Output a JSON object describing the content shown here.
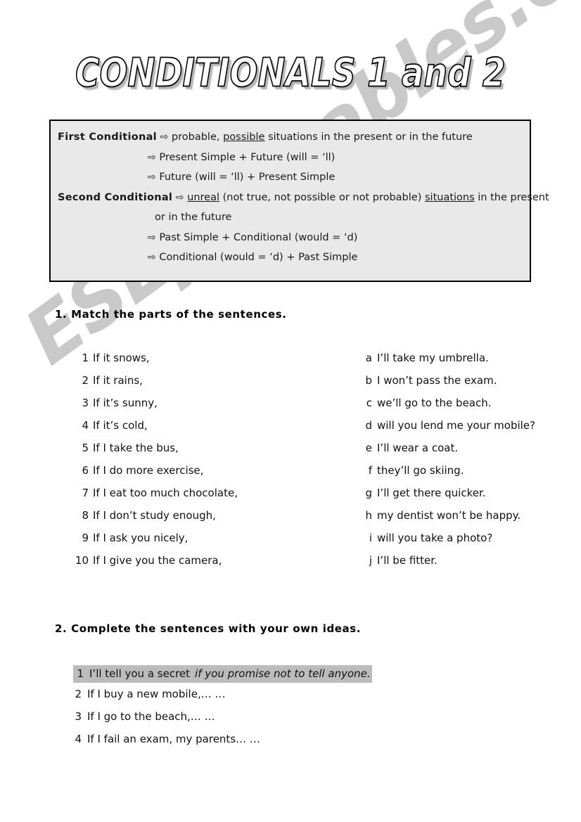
{
  "watermark": {
    "text": "ESLprintables.com"
  },
  "title": {
    "text": "CONDITIONALS 1 and 2"
  },
  "grammar_box": {
    "arrow_icon": "⇨",
    "lines": [
      {
        "label": "First Conditional",
        "indent": "head",
        "arrow": true,
        "parts": [
          {
            "text": "probable, ",
            "underline": false
          },
          {
            "text": "possible",
            "underline": true
          },
          {
            "text": " situations in the present or in the future",
            "underline": false
          }
        ]
      },
      {
        "label": "",
        "indent": "ind",
        "arrow": true,
        "parts": [
          {
            "text": "Present Simple + Future (will = ‘ll)",
            "underline": false
          }
        ]
      },
      {
        "label": "",
        "indent": "ind",
        "arrow": true,
        "parts": [
          {
            "text": "Future (will = ‘ll) + Present Simple",
            "underline": false
          }
        ]
      },
      {
        "label": "Second Conditional",
        "indent": "head",
        "arrow": true,
        "parts": [
          {
            "text": "unreal",
            "underline": true
          },
          {
            "text": " (not true, not possible or not probable) ",
            "underline": false
          },
          {
            "text": "situations",
            "underline": true
          },
          {
            "text": " in the present",
            "underline": false
          }
        ]
      },
      {
        "label": "",
        "indent": "ind2",
        "arrow": false,
        "parts": [
          {
            "text": "or in the future",
            "underline": false
          }
        ]
      },
      {
        "label": "",
        "indent": "ind",
        "arrow": true,
        "parts": [
          {
            "text": "Past Simple + Conditional (would = ‘d)",
            "underline": false
          }
        ]
      },
      {
        "label": "",
        "indent": "ind",
        "arrow": true,
        "parts": [
          {
            "text": "Conditional (would = ‘d) + Past Simple",
            "underline": false
          }
        ]
      }
    ]
  },
  "exercise1": {
    "heading": "1. Match the parts of the sentences.",
    "left_items": [
      {
        "marker": "1",
        "text": "If it snows,"
      },
      {
        "marker": "2",
        "text": "If it rains,"
      },
      {
        "marker": "3",
        "text": "If it’s sunny,"
      },
      {
        "marker": "4",
        "text": "If it’s cold,"
      },
      {
        "marker": "5",
        "text": "If I take the bus,"
      },
      {
        "marker": "6",
        "text": "If I do more exercise,"
      },
      {
        "marker": "7",
        "text": "If I eat too much chocolate,"
      },
      {
        "marker": "8",
        "text": "If I don’t study enough,"
      },
      {
        "marker": "9",
        "text": "If I ask you nicely,"
      },
      {
        "marker": "10",
        "text": "If I give you the camera,"
      }
    ],
    "right_items": [
      {
        "marker": "a",
        "text": "I’ll take my umbrella."
      },
      {
        "marker": "b",
        "text": "I won’t pass the exam."
      },
      {
        "marker": "c",
        "text": "we’ll go to the beach."
      },
      {
        "marker": "d",
        "text": "will you lend me your mobile?"
      },
      {
        "marker": "e",
        "text": "I’ll wear a coat."
      },
      {
        "marker": "f",
        "text": "they’ll go skiing."
      },
      {
        "marker": "g",
        "text": "I’ll get there quicker."
      },
      {
        "marker": "h",
        "text": "my dentist won’t be happy."
      },
      {
        "marker": "i",
        "text": "will you take a photo?"
      },
      {
        "marker": "j",
        "text": "I’ll be fitter."
      }
    ]
  },
  "exercise2": {
    "heading": "2. Complete the sentences with your own ideas.",
    "items": [
      {
        "marker": "1",
        "text": "I’ll tell you a secret",
        "answer": "if you promise not to tell anyone.",
        "highlighted": true
      },
      {
        "marker": "2",
        "text": "If I buy a new mobile,… …",
        "answer": "",
        "highlighted": false
      },
      {
        "marker": "3",
        "text": "If I go to the beach,… …",
        "answer": "",
        "highlighted": false
      },
      {
        "marker": "4",
        "text": "If I fail an exam, my parents… …",
        "answer": "",
        "highlighted": false
      }
    ]
  }
}
